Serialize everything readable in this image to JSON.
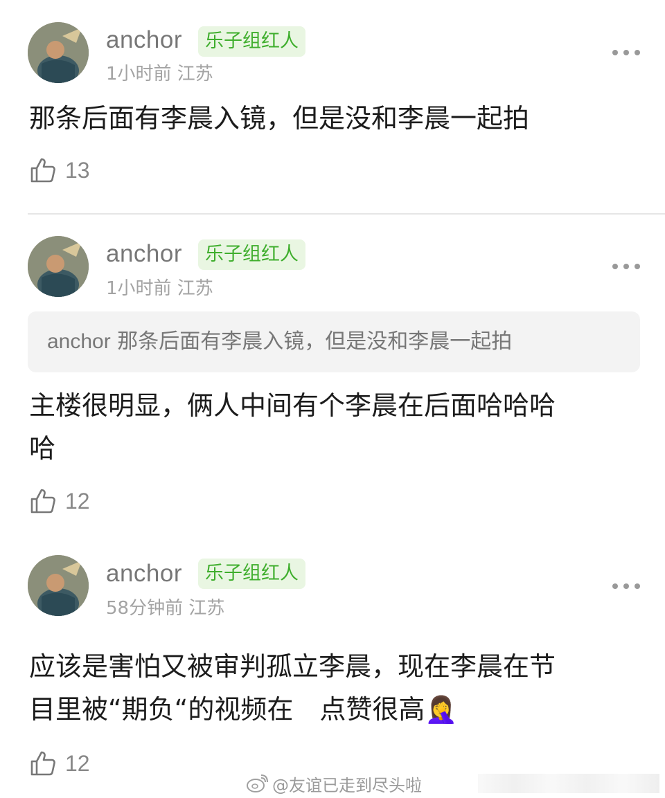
{
  "comments": [
    {
      "username": "anchor",
      "badge": "乐子组红人",
      "meta": "1小时前 江苏",
      "text": "那条后面有李晨入镜，但是没和李晨一起拍",
      "likes": "13"
    },
    {
      "username": "anchor",
      "badge": "乐子组红人",
      "meta": "1小时前 江苏",
      "quote_user": "anchor",
      "quote_text": "那条后面有李晨入镜，但是没和李晨一起拍",
      "text_line1": "主楼很明显，俩人中间有个李晨在后面哈哈哈",
      "text_line2": "哈",
      "likes": "12"
    },
    {
      "username": "anchor",
      "badge": "乐子组红人",
      "meta": "58分钟前 江苏",
      "text_line1": "应该是害怕又被审判孤立李晨，现在李晨在节",
      "text_line2": "目里被“期负“的视频在　点赞很高🤦‍♀️",
      "likes": "12"
    }
  ],
  "watermark": "@友谊已走到尽头啦",
  "icons": {
    "avatar": "avatar-image",
    "more": "more-dots-icon",
    "like": "thumbs-up-icon",
    "weibo": "weibo-logo-icon"
  },
  "colors": {
    "badge_bg": "#e9f6e2",
    "badge_text": "#3fae2d",
    "meta": "#a3a3a3",
    "quote_bg": "#f3f3f3"
  }
}
